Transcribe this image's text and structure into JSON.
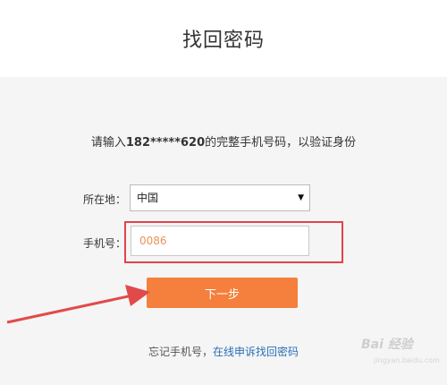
{
  "header": {
    "title": "找回密码"
  },
  "instruction": {
    "prefix": "请输入",
    "masked_number": "182*****620",
    "suffix": "的完整手机号码，以验证身份"
  },
  "form": {
    "region_label": "所在地：",
    "region_value": "中国",
    "phone_label": "手机号：",
    "phone_value": "0086",
    "next_button": "下一步"
  },
  "footer": {
    "forgot_text": "忘记手机号，",
    "appeal_link": "在线申诉找回密码"
  },
  "watermark": {
    "logo_text": "Bai 经验",
    "url": "jingyan.baidu.com"
  },
  "colors": {
    "accent": "#f57f3c",
    "highlight_box": "#e0444a",
    "link": "#2a6fb6"
  }
}
